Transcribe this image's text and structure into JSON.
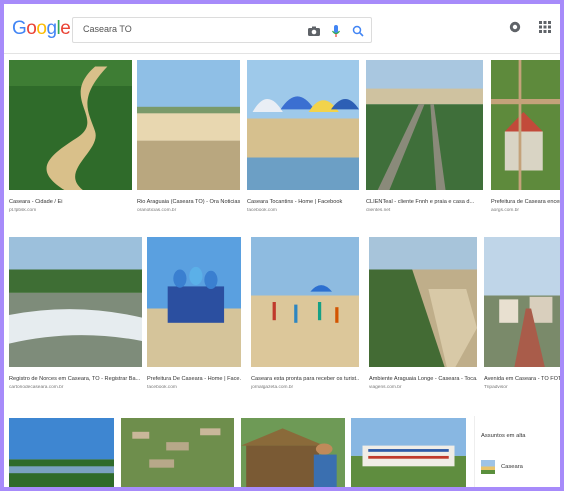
{
  "header": {
    "logo_letters": [
      {
        "ch": "G",
        "color": "#4285F4"
      },
      {
        "ch": "o",
        "color": "#EA4335"
      },
      {
        "ch": "o",
        "color": "#FBBC05"
      },
      {
        "ch": "g",
        "color": "#4285F4"
      },
      {
        "ch": "l",
        "color": "#34A853"
      },
      {
        "ch": "e",
        "color": "#EA4335"
      }
    ],
    "search_value": "Caseara TO",
    "icons": [
      "camera-icon",
      "microphone-icon",
      "search-icon",
      "settings-icon",
      "apps-grid-icon"
    ]
  },
  "results": [
    {
      "caption": "Caseara - Cidade / Ei",
      "source": "pt.fpbsk.com",
      "scene": "river-forest"
    },
    {
      "caption": "Rio Araguaia (Caseara TO) - Ora Noticias",
      "source": "oranoticias.com.br",
      "scene": "beach"
    },
    {
      "caption": "Caseara Tocantins - Home | Facebook",
      "source": "facebook.com",
      "scene": "umbrellas"
    },
    {
      "caption": "CLIENTeal - cliente Fnnh e praia e casa d...",
      "source": "clientes.net",
      "scene": "aerial-town"
    },
    {
      "caption": "Prefeitura de Caseara encerra...",
      "source": "aorgs.com.br",
      "scene": "church-aerial"
    },
    {
      "caption": "Registro de Norces em Caseara, TO - Registrar Ba...",
      "source": "cartoriodecaseara.com.br",
      "scene": "rapids"
    },
    {
      "caption": "Prefeitura De Caseara - Home | Face...",
      "source": "facebook.com",
      "scene": "sign"
    },
    {
      "caption": "Caseara esta pronta para receber os turist...",
      "source": "jornalgazeta.com.br",
      "scene": "beach-people"
    },
    {
      "caption": "Ambiente Araguaia Longe - Caseara - Toca...",
      "source": "viagens.com.br",
      "scene": "river-aerial"
    },
    {
      "caption": "Avenida em Caseara - TO FOTO",
      "source": "Tripadvisor",
      "scene": "street"
    },
    {
      "caption": "",
      "source": "",
      "scene": "river-sky"
    },
    {
      "caption": "",
      "source": "",
      "scene": "town-aerial"
    },
    {
      "caption": "",
      "source": "",
      "scene": "hut-person"
    },
    {
      "caption": "",
      "source": "",
      "scene": "caseara-letters"
    }
  ],
  "related": {
    "title": "Assuntos em alta",
    "items": [
      {
        "label": "Caseara"
      }
    ]
  },
  "colors": {
    "page_border": "#a78bfa"
  }
}
